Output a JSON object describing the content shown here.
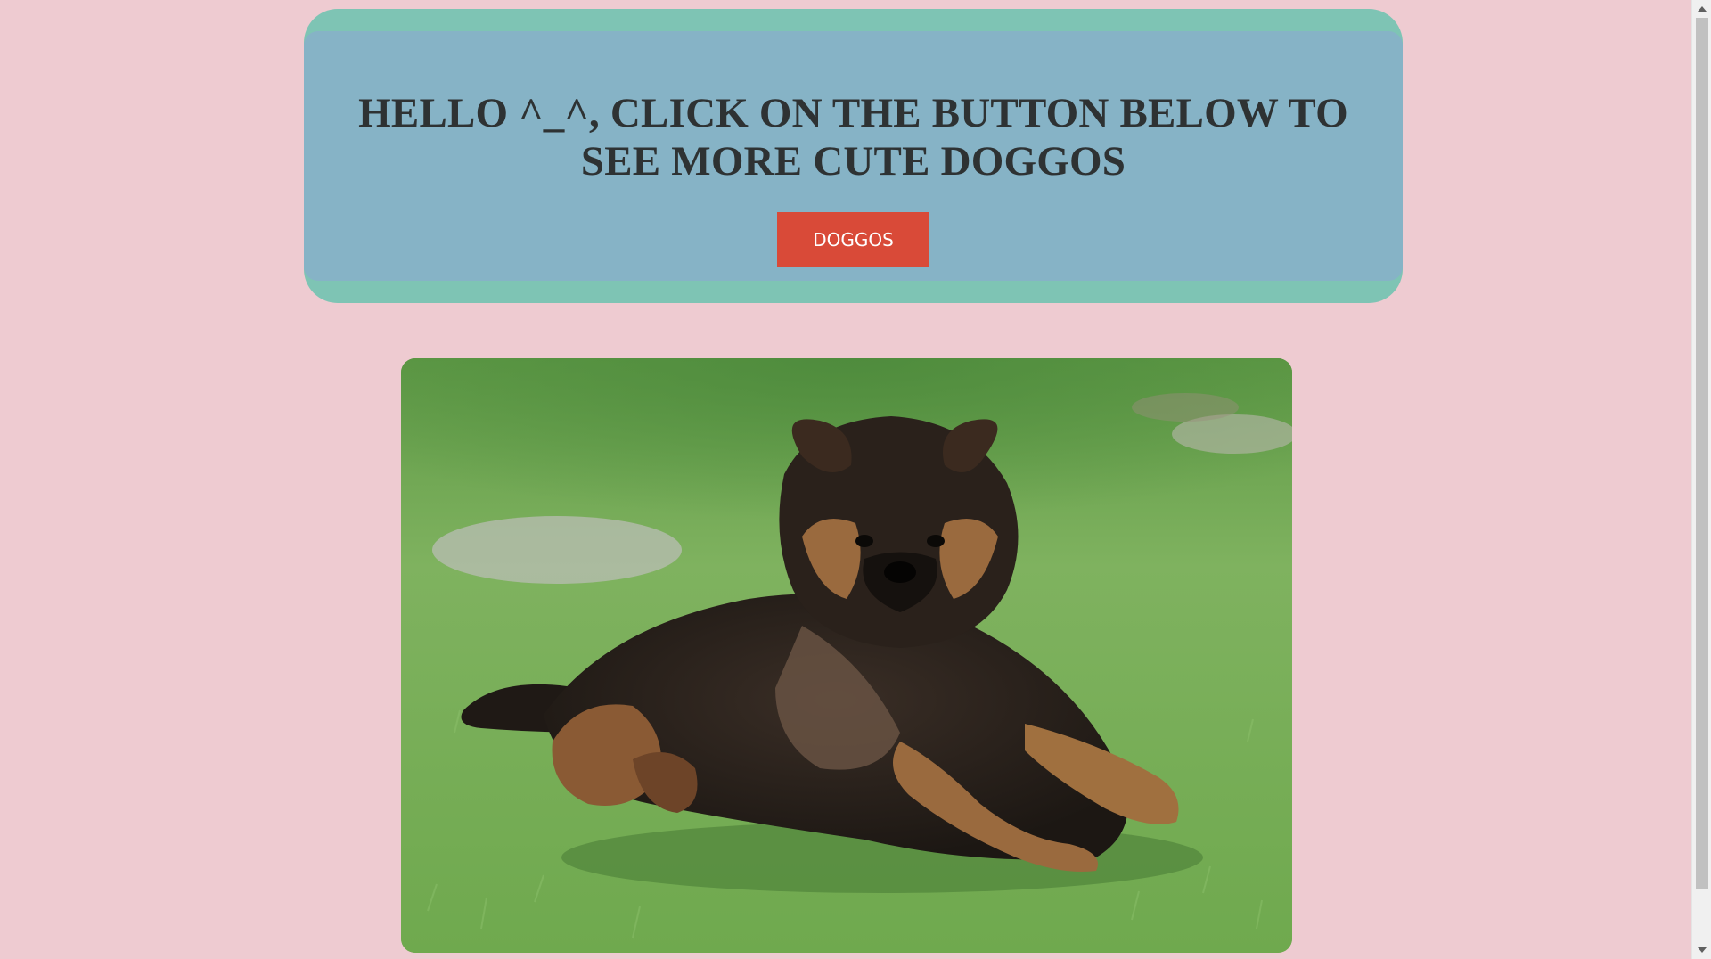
{
  "header": {
    "headline": "HELLO ^_^, CLICK ON THE BUTTON BELOW TO SEE MORE CUTE DOGGOS",
    "button_label": "DOGGOS"
  },
  "photo": {
    "subject": "german-shepherd-puppy-on-grass"
  },
  "colors": {
    "page_background": "#eecbd1",
    "banner_outer": "#7ec4b4",
    "banner_inner": "#86b3c6",
    "button": "#d94a38",
    "headline_text": "#2e3233"
  }
}
